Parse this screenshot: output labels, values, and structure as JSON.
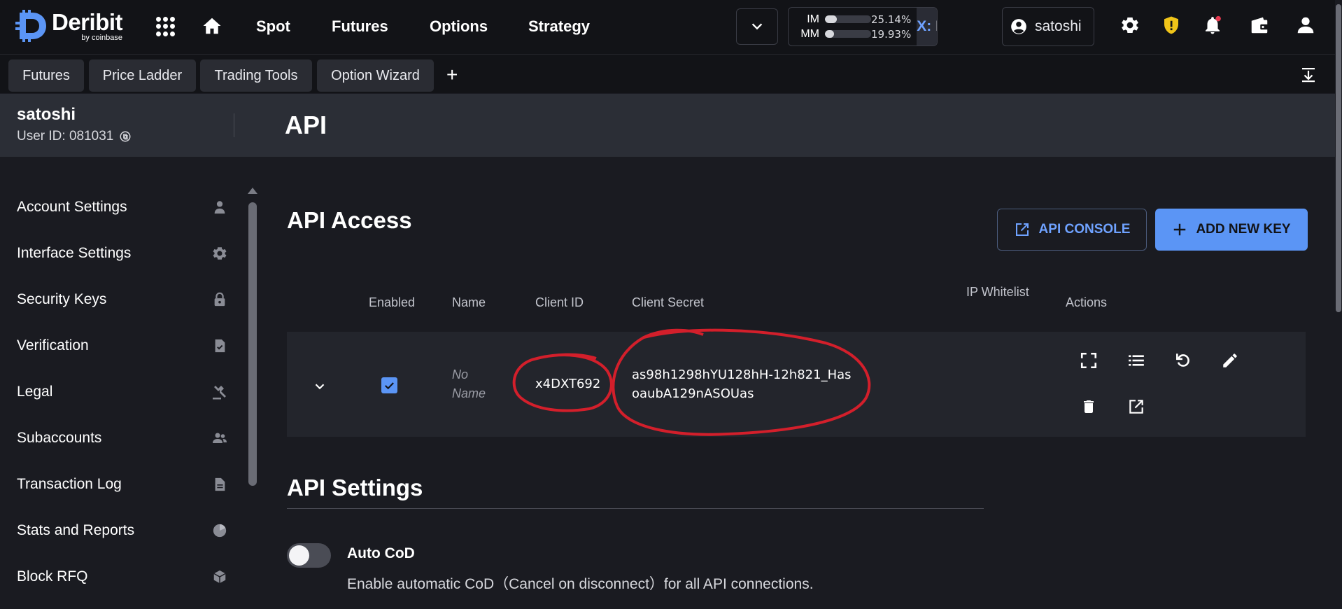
{
  "brand": {
    "name": "Deribit",
    "byline": "by coinbase",
    "accent_color": "#5b95f5"
  },
  "topnav": {
    "items": [
      "Spot",
      "Futures",
      "Options",
      "Strategy"
    ]
  },
  "margin": {
    "im_label": "IM",
    "im_value": "25.14%",
    "im_fraction": 0.2514,
    "mm_label": "MM",
    "mm_value": "19.93%",
    "mm_fraction": 0.1993,
    "mode_prefix": "X:",
    "mode": "PM"
  },
  "user": {
    "username": "satoshi",
    "user_id_label": "User ID: 081031"
  },
  "tabs": [
    "Futures",
    "Price Ladder",
    "Trading Tools",
    "Option Wizard"
  ],
  "tabs_add_label": "+",
  "page": {
    "title": "API"
  },
  "sidebar": {
    "items": [
      {
        "label": "Account Settings",
        "icon": "person-icon"
      },
      {
        "label": "Interface Settings",
        "icon": "gear-icon"
      },
      {
        "label": "Security Keys",
        "icon": "lock-icon"
      },
      {
        "label": "Verification",
        "icon": "file-check-icon"
      },
      {
        "label": "Legal",
        "icon": "gavel-icon"
      },
      {
        "label": "Subaccounts",
        "icon": "people-icon"
      },
      {
        "label": "Transaction Log",
        "icon": "document-icon"
      },
      {
        "label": "Stats and Reports",
        "icon": "pie-chart-icon"
      },
      {
        "label": "Block RFQ",
        "icon": "cube-icon"
      }
    ]
  },
  "api_access": {
    "title": "API Access",
    "console_label": "API CONSOLE",
    "add_key_label": "ADD NEW KEY",
    "columns": {
      "enabled": "Enabled",
      "name": "Name",
      "client_id": "Client ID",
      "client_secret": "Client Secret",
      "ip_whitelist": "IP Whitelist",
      "actions": "Actions"
    },
    "rows": [
      {
        "enabled": true,
        "name": "No Name",
        "client_id": "x4DXT692",
        "client_secret": "as98h1298hYU128hH-12h821_HasoaubA129nASOUas",
        "ip_whitelist": ""
      }
    ]
  },
  "api_settings": {
    "title": "API Settings",
    "auto_cod": {
      "label": "Auto CoD",
      "description": "Enable automatic CoD（Cancel on disconnect）for all API connections.",
      "enabled": false
    }
  }
}
